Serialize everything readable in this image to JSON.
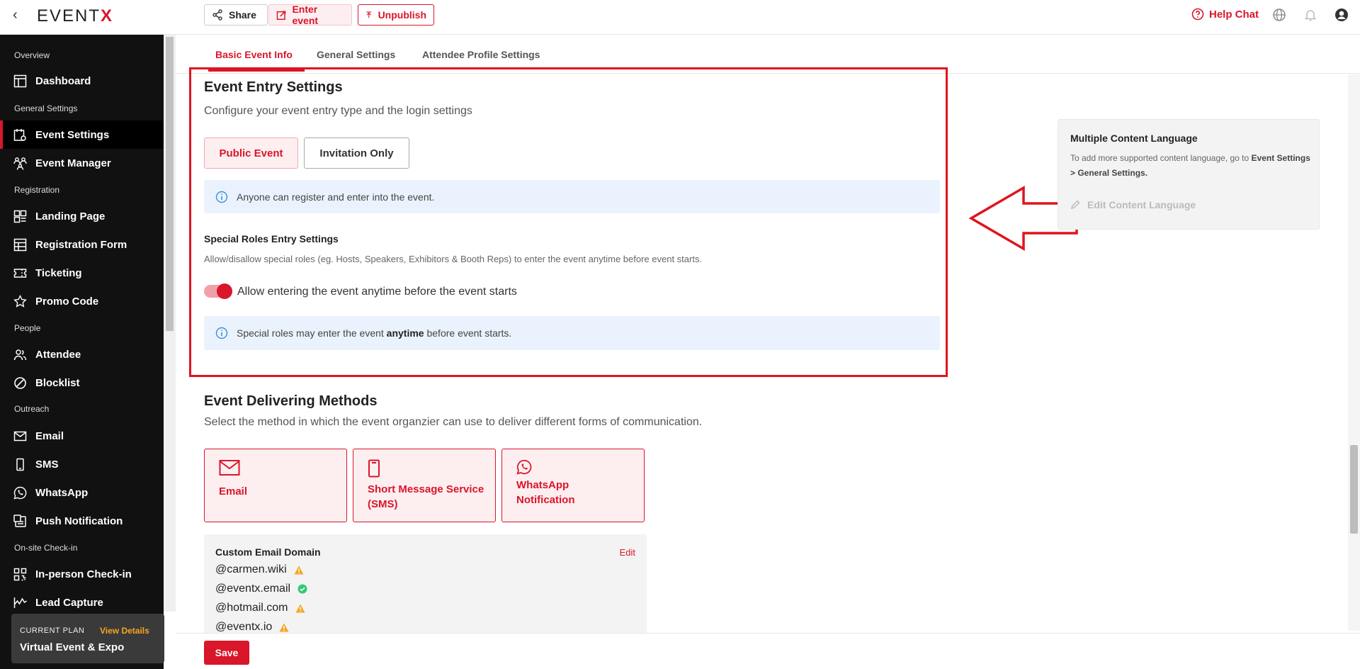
{
  "topbar": {
    "logo_text": "EVENT",
    "logo_accent": "X",
    "share_label": "Share",
    "enter_label": "Enter event",
    "unpublish_label": "Unpublish",
    "help_label": "Help Chat"
  },
  "sidebar": {
    "sections": {
      "overview": "Overview",
      "general": "General Settings",
      "registration": "Registration",
      "people": "People",
      "outreach": "Outreach",
      "onsite": "On-site Check-in"
    },
    "items": {
      "dashboard": "Dashboard",
      "event_settings": "Event Settings",
      "event_manager": "Event Manager",
      "landing_page": "Landing Page",
      "registration_form": "Registration Form",
      "ticketing": "Ticketing",
      "promo_code": "Promo Code",
      "attendee": "Attendee",
      "blocklist": "Blocklist",
      "email": "Email",
      "sms": "SMS",
      "whatsapp": "WhatsApp",
      "push": "Push Notification",
      "inperson": "In-person Check-in",
      "lead": "Lead Capture"
    },
    "plan": {
      "label": "CURRENT PLAN",
      "view_details": "View Details",
      "name": "Virtual Event & Expo"
    }
  },
  "tabs": {
    "basic": "Basic Event Info",
    "general": "General Settings",
    "profile": "Attendee Profile Settings"
  },
  "entry": {
    "title": "Event Entry Settings",
    "subtitle": "Configure your event entry type and the login settings",
    "public_label": "Public Event",
    "invite_label": "Invitation Only",
    "info_text": "Anyone can register and enter into the event.",
    "special_title": "Special Roles Entry Settings",
    "special_desc": "Allow/disallow special roles (eg. Hosts, Speakers, Exhibitors & Booth Reps) to enter the event anytime before event starts.",
    "toggle_on": true,
    "toggle_label": "Allow entering the event anytime before the event starts",
    "special_info_pre": "Special roles may enter the event",
    "special_info_bold": "anytime",
    "special_info_post": "before event starts."
  },
  "delivery": {
    "title": "Event Delivering Methods",
    "subtitle": "Select the method in which the event organzier can use to deliver different forms of communication.",
    "methods": {
      "email": "Email",
      "sms_line1": "Short Message Service",
      "sms_line2": "(SMS)",
      "wa_line1": "WhatsApp",
      "wa_line2": "Notification"
    }
  },
  "domains": {
    "title": "Custom Email Domain",
    "edit_label": "Edit",
    "list": [
      {
        "name": "@carmen.wiki",
        "status": "warning"
      },
      {
        "name": "@eventx.email",
        "status": "verified"
      },
      {
        "name": "@hotmail.com",
        "status": "warning"
      },
      {
        "name": "@eventx.io",
        "status": "warning"
      }
    ]
  },
  "language_card": {
    "title": "Multiple Content Language",
    "desc_pre": "To add more supported content language, go to",
    "desc_bold": "Event Settings > General Settings.",
    "edit_label": "Edit Content Language"
  },
  "footer": {
    "save_label": "Save"
  },
  "colors": {
    "accent": "#d9162a",
    "sidebar_bg": "#111111",
    "info_bg": "#eaf3fd",
    "warning": "#f5a623",
    "verified": "#2ecc71"
  }
}
